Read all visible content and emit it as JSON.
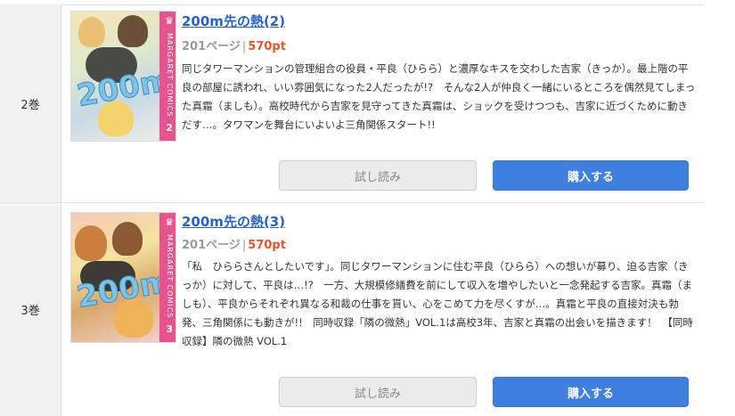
{
  "volumes": [
    {
      "vol_label": "2巻",
      "title": "200m先の熱(2)",
      "pages": "201ページ",
      "separator": "|",
      "price": "570pt",
      "description": "同じタワーマンションの管理組合の役員・平良（ひらら）と濃厚なキスを交わした吉家（きっか）。最上階の平良の部屋に誘われ、いい雰囲気になった2人だったが!?　そんな2人が仲良く一緒にいるところを偶然見てしまった真霜（ましも）。高校時代から吉家を見守ってきた真霜は、ショックを受けつつも、吉家に近づくために動きだす…。タワマンを舞台にいよいよ三角関係スタート!!",
      "cover": {
        "title_text": "200m",
        "spine_text": "MARGARET COMICS",
        "number": "2",
        "crown": "♛"
      },
      "trial_label": "試し読み",
      "buy_label": "購入する"
    },
    {
      "vol_label": "3巻",
      "title": "200m先の熱(3)",
      "pages": "201ページ",
      "separator": "|",
      "price": "570pt",
      "description": "「私　ひららさんとしたいです」。同じタワーマンションに住む平良（ひらら）への想いが募り、迫る吉家（きっか）に対して、平良は…!?　一方、大規模修繕費を前にして収入を増やしたいと一念発起する吉家。真霜（ましも）、平良からそれぞれ異なる和裁の仕事を貰い、心をこめて力を尽くすが…。真霜と平良の直接対決も勃発、三角関係にも動きが!!　同時収録「隣の微熱」VOL.1は高校3年、吉家と真霜の出会いを描きます！　【同時収録】隣の微熱 VOL.1",
      "cover": {
        "title_text": "200m",
        "spine_text": "MARGARET COMICS",
        "number": "3",
        "crown": "♛"
      },
      "trial_label": "試し読み",
      "buy_label": "購入する"
    }
  ],
  "colors": {
    "link": "#2763c5",
    "price": "#e5572b",
    "buy_button": "#3f7fe0",
    "trial_button": "#ececec",
    "cover_spine": "#e8528f"
  }
}
